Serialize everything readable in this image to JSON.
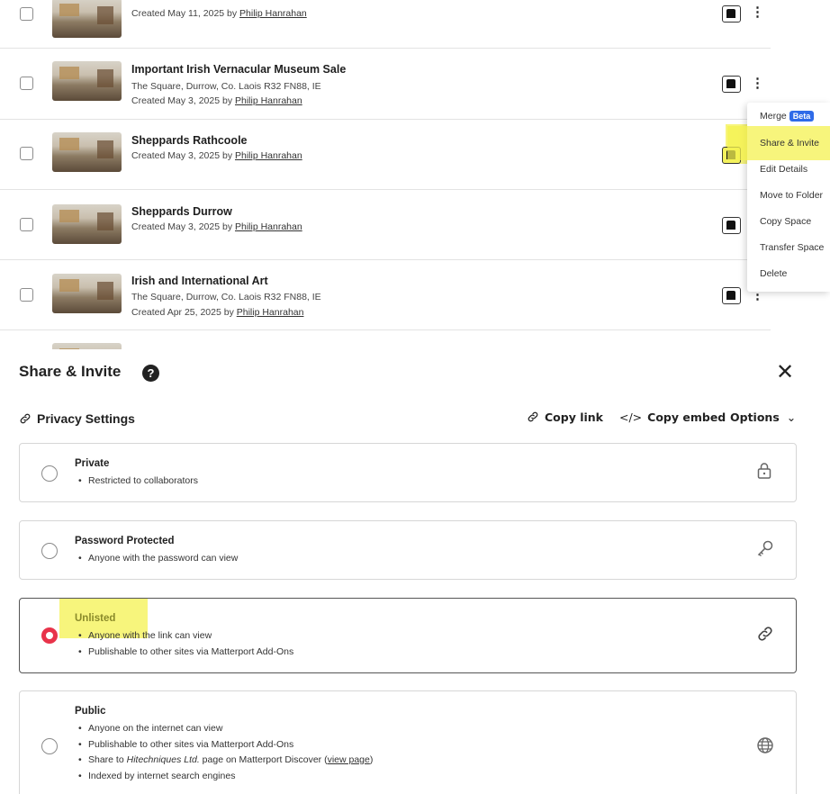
{
  "spaces": [
    {
      "title": "",
      "address": "",
      "created": "Created May 11, 2025 by ",
      "author": "Philip Hanrahan"
    },
    {
      "title": "Important Irish Vernacular Museum Sale",
      "address": "The Square, Durrow, Co. Laois R32 FN88, IE",
      "created": "Created May 3, 2025 by ",
      "author": "Philip Hanrahan"
    },
    {
      "title": "Sheppards Rathcoole",
      "address": "",
      "created": "Created May 3, 2025 by ",
      "author": "Philip Hanrahan"
    },
    {
      "title": "Sheppards Durrow",
      "address": "",
      "created": "Created May 3, 2025 by ",
      "author": "Philip Hanrahan"
    },
    {
      "title": "Irish and International Art",
      "address": "The Square, Durrow, Co. Laois R32 FN88, IE",
      "created": "Created Apr 25, 2025 by ",
      "author": "Philip Hanrahan"
    }
  ],
  "context_menu": {
    "items": [
      "Merge",
      "Share & Invite",
      "Edit Details",
      "Move to Folder",
      "Copy Space",
      "Transfer Space",
      "Delete"
    ],
    "beta_badge": "Beta",
    "highlighted": "Share & Invite"
  },
  "dialog": {
    "title": "Share & Invite",
    "help_icon": "?",
    "close_icon": "✕",
    "privacy_label": "Privacy Settings",
    "copy_link": "Copy link",
    "copy_embed": "Copy embed",
    "options": "Options",
    "options_chevron": "⌄",
    "selected": "Unlisted",
    "settings": [
      {
        "name": "Private",
        "icon": "lock-icon",
        "bullets": [
          "Restricted to collaborators"
        ]
      },
      {
        "name": "Password Protected",
        "icon": "key-icon",
        "bullets": [
          "Anyone with the password can view"
        ]
      },
      {
        "name": "Unlisted",
        "icon": "link-icon",
        "bullets": [
          "Anyone with the link can view",
          "Publishable to other sites via Matterport Add-Ons"
        ]
      },
      {
        "name": "Public",
        "icon": "globe-icon",
        "bullets": [
          "Anyone on the internet can view",
          "Publishable to other sites via Matterport Add-Ons"
        ],
        "discover_prefix": "Share to ",
        "discover_company": "Hitechniques Ltd.",
        "discover_middle": " page on Matterport Discover (",
        "discover_link": "view page",
        "discover_suffix": ")",
        "last_bullet": "Indexed by internet search engines"
      }
    ]
  },
  "colors": {
    "accent_radio": "#e8334a",
    "highlight": "#f4f150",
    "beta": "#2f6be8"
  }
}
